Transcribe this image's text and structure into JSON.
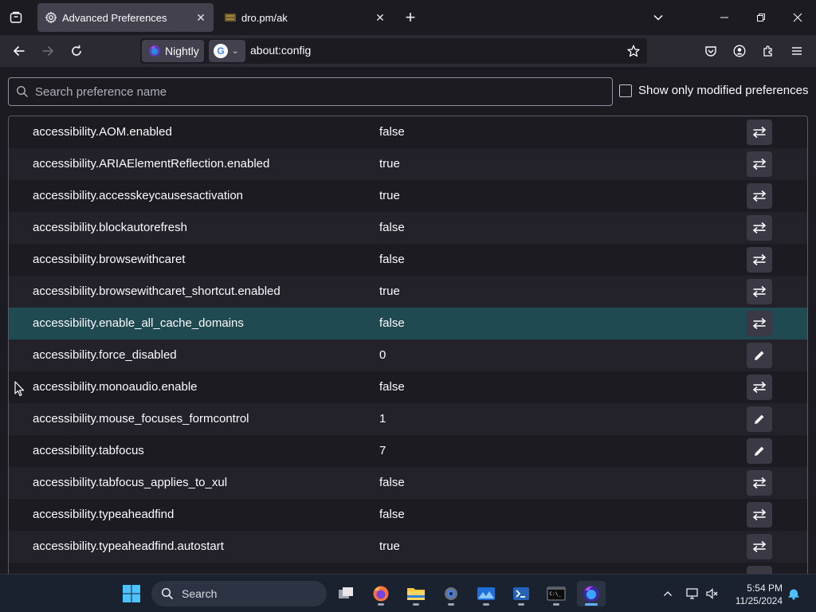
{
  "tabs": [
    {
      "title": "Advanced Preferences",
      "icon": "gear-icon",
      "active": true
    },
    {
      "title": "dro.pm/ak",
      "icon": "site-favicon",
      "active": false
    }
  ],
  "toolbar": {
    "identity_label": "Nightly",
    "url": "about:config",
    "search_engine": "G"
  },
  "config": {
    "search_placeholder": "Search preference name",
    "search_value": "",
    "show_modified_label": "Show only modified preferences",
    "show_modified_checked": false
  },
  "prefs": [
    {
      "name": "accessibility.AOM.enabled",
      "value": "false",
      "action": "toggle"
    },
    {
      "name": "accessibility.ARIAElementReflection.enabled",
      "value": "true",
      "action": "toggle"
    },
    {
      "name": "accessibility.accesskeycausesactivation",
      "value": "true",
      "action": "toggle"
    },
    {
      "name": "accessibility.blockautorefresh",
      "value": "false",
      "action": "toggle"
    },
    {
      "name": "accessibility.browsewithcaret",
      "value": "false",
      "action": "toggle"
    },
    {
      "name": "accessibility.browsewithcaret_shortcut.enabled",
      "value": "true",
      "action": "toggle"
    },
    {
      "name": "accessibility.enable_all_cache_domains",
      "value": "false",
      "action": "toggle",
      "hovered": true
    },
    {
      "name": "accessibility.force_disabled",
      "value": "0",
      "action": "edit"
    },
    {
      "name": "accessibility.monoaudio.enable",
      "value": "false",
      "action": "toggle"
    },
    {
      "name": "accessibility.mouse_focuses_formcontrol",
      "value": "1",
      "action": "edit"
    },
    {
      "name": "accessibility.tabfocus",
      "value": "7",
      "action": "edit"
    },
    {
      "name": "accessibility.tabfocus_applies_to_xul",
      "value": "false",
      "action": "toggle"
    },
    {
      "name": "accessibility.typeaheadfind",
      "value": "false",
      "action": "toggle"
    },
    {
      "name": "accessibility.typeaheadfind.autostart",
      "value": "true",
      "action": "toggle"
    },
    {
      "name": "",
      "value": "",
      "action": "edit"
    }
  ],
  "taskbar": {
    "search_label": "Search",
    "time": "5:54 PM",
    "date": "11/25/2024"
  },
  "colors": {
    "hover_row": "#1f4a52",
    "accent": "#5fb2ff"
  }
}
